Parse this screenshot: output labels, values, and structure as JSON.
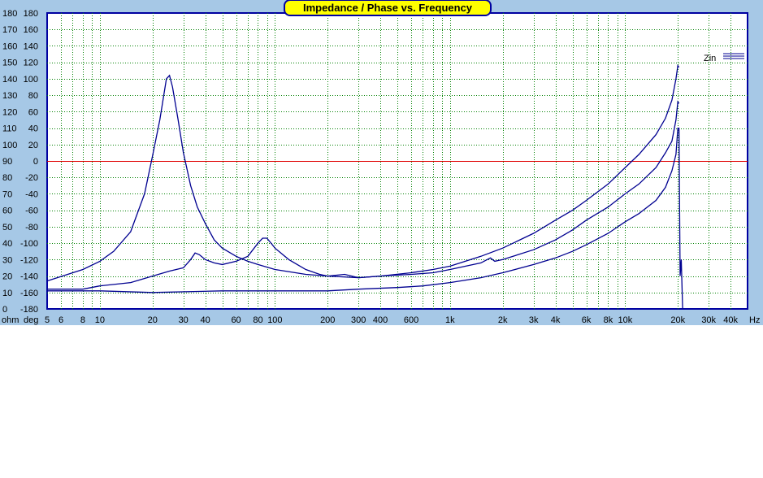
{
  "chart_data": {
    "type": "line",
    "title": "Impedance / Phase vs. Frequency",
    "x_scale": "log",
    "x_unit": "Hz",
    "xlim": [
      5,
      50000
    ],
    "x_tick_labels": [
      {
        "v": 5,
        "label": "5"
      },
      {
        "v": 6,
        "label": "6"
      },
      {
        "v": 8,
        "label": "8"
      },
      {
        "v": 10,
        "label": "10"
      },
      {
        "v": 20,
        "label": "20"
      },
      {
        "v": 30,
        "label": "30"
      },
      {
        "v": 40,
        "label": "40"
      },
      {
        "v": 60,
        "label": "60"
      },
      {
        "v": 80,
        "label": "80"
      },
      {
        "v": 100,
        "label": "100"
      },
      {
        "v": 200,
        "label": "200"
      },
      {
        "v": 300,
        "label": "300"
      },
      {
        "v": 400,
        "label": "400"
      },
      {
        "v": 600,
        "label": "600"
      },
      {
        "v": 1000,
        "label": "1k"
      },
      {
        "v": 2000,
        "label": "2k"
      },
      {
        "v": 3000,
        "label": "3k"
      },
      {
        "v": 4000,
        "label": "4k"
      },
      {
        "v": 6000,
        "label": "6k"
      },
      {
        "v": 8000,
        "label": "8k"
      },
      {
        "v": 10000,
        "label": "10k"
      },
      {
        "v": 20000,
        "label": "20k"
      },
      {
        "v": 30000,
        "label": "30k"
      },
      {
        "v": 40000,
        "label": "40k"
      }
    ],
    "y_left_label": "ohm",
    "y_left_lim": [
      0,
      180
    ],
    "y_left_ticks": [
      0,
      10,
      20,
      30,
      40,
      50,
      60,
      70,
      80,
      90,
      100,
      110,
      120,
      130,
      140,
      150,
      160,
      170,
      180
    ],
    "y_right_label": "deg",
    "y_right_lim": [
      -180,
      180
    ],
    "y_right_ticks": [
      -180,
      -160,
      -140,
      -120,
      -100,
      -80,
      -60,
      -40,
      -20,
      0,
      20,
      40,
      60,
      80,
      100,
      120,
      140,
      160,
      180
    ],
    "reference_line": {
      "axis": "ohm",
      "value": 90,
      "color": "#e00000"
    },
    "grid": true,
    "legend": {
      "position": "top-right",
      "entries": [
        "Zin"
      ]
    },
    "series": [
      {
        "name": "Zin",
        "color": "#000090",
        "x": [
          5,
          8,
          10,
          12,
          15,
          18,
          20,
          22,
          24,
          25,
          26,
          28,
          30,
          33,
          36,
          40,
          45,
          50,
          60,
          70,
          80,
          100,
          150,
          200,
          300,
          400,
          600,
          800,
          1000,
          1500,
          2000,
          3000,
          4000,
          5000,
          6000,
          8000,
          10000,
          12000,
          15000,
          17000,
          18500,
          19500,
          20000,
          20300
        ],
        "y": [
          17,
          24,
          29,
          35,
          47,
          70,
          93,
          115,
          140,
          142,
          135,
          115,
          95,
          75,
          62,
          52,
          42,
          37,
          32,
          29,
          27,
          24,
          21,
          20,
          19,
          20,
          22,
          24,
          26,
          32,
          37,
          46,
          54,
          60,
          66,
          76,
          86,
          94,
          106,
          116,
          127,
          140,
          148,
          147
        ]
      },
      {
        "name": "",
        "color": "#000090",
        "x": [
          5,
          8,
          10,
          15,
          20,
          25,
          30,
          33,
          35,
          37,
          40,
          45,
          50,
          60,
          70,
          80,
          85,
          90,
          95,
          100,
          120,
          150,
          180,
          200,
          250,
          300,
          400,
          600,
          800,
          1000,
          1500,
          1700,
          1800,
          2000,
          3000,
          4000,
          5000,
          6000,
          8000,
          10000,
          12000,
          15000,
          17000,
          18500,
          19500,
          20000,
          20300
        ],
        "y": [
          12,
          12,
          14,
          16,
          20,
          23,
          25,
          30,
          34,
          33,
          30,
          28,
          27,
          29,
          32,
          40,
          43,
          43,
          40,
          37,
          30,
          24,
          21,
          20,
          21,
          19,
          20,
          21,
          22,
          24,
          28,
          31,
          29,
          30,
          36,
          42,
          48,
          54,
          62,
          70,
          76,
          86,
          95,
          102,
          115,
          126,
          125
        ]
      },
      {
        "name": "",
        "color": "#000090",
        "x": [
          5,
          10,
          20,
          50,
          100,
          200,
          300,
          500,
          700,
          1000,
          1500,
          2000,
          3000,
          4000,
          5000,
          6000,
          8000,
          10000,
          12000,
          15000,
          17000,
          18500,
          19500,
          20000,
          20300,
          20600,
          20900,
          21300
        ],
        "y": [
          11,
          11,
          10,
          11,
          11,
          11,
          12,
          13,
          14,
          16,
          19,
          22,
          27,
          31,
          35,
          39,
          46,
          53,
          58,
          66,
          74,
          84,
          94,
          110,
          110,
          20,
          30,
          0
        ]
      }
    ]
  }
}
